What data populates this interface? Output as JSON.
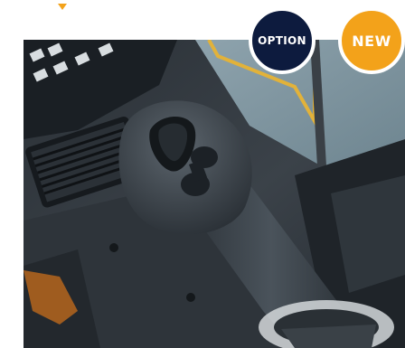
{
  "badges": {
    "option": {
      "label": "OPTION",
      "color": "#0d1b3e"
    },
    "new": {
      "label": "NEW",
      "color": "#f3a21a"
    }
  },
  "icons": {
    "pointer": "triangle-down-icon"
  },
  "photo": {
    "subject": "joystick-control-lever"
  },
  "colors": {
    "accent": "#f3a21a",
    "navy": "#0d1b3e"
  }
}
